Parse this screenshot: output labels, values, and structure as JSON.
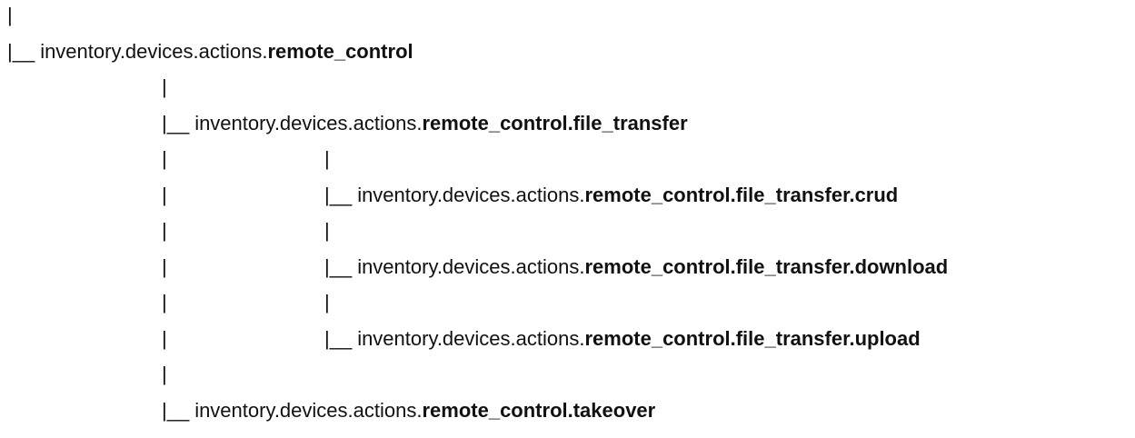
{
  "tree": {
    "connector_bar": "|",
    "connector_branch": "|__",
    "rows": [
      {
        "kind": "bar",
        "bars": [
          0
        ]
      },
      {
        "kind": "node",
        "bars": [],
        "branch": 0,
        "prefix": "inventory.devices.actions.",
        "bold": "remote_control"
      },
      {
        "kind": "bar",
        "bars": [
          1
        ]
      },
      {
        "kind": "node",
        "bars": [],
        "branch": 1,
        "prefix": "inventory.devices.actions.",
        "bold": "remote_control.file_transfer"
      },
      {
        "kind": "bar",
        "bars": [
          1,
          2
        ]
      },
      {
        "kind": "node",
        "bars": [
          1
        ],
        "branch": 2,
        "prefix": "inventory.devices.actions.",
        "bold": "remote_control.file_transfer.crud"
      },
      {
        "kind": "bar",
        "bars": [
          1,
          2
        ]
      },
      {
        "kind": "node",
        "bars": [
          1
        ],
        "branch": 2,
        "prefix": "inventory.devices.actions.",
        "bold": "remote_control.file_transfer.download"
      },
      {
        "kind": "bar",
        "bars": [
          1,
          2
        ]
      },
      {
        "kind": "node",
        "bars": [
          1
        ],
        "branch": 2,
        "prefix": "inventory.devices.actions.",
        "bold": "remote_control.file_transfer.upload"
      },
      {
        "kind": "bar",
        "bars": [
          1
        ]
      },
      {
        "kind": "node",
        "bars": [],
        "branch": 1,
        "prefix": "inventory.devices.actions.",
        "bold": "remote_control.takeover"
      }
    ]
  }
}
